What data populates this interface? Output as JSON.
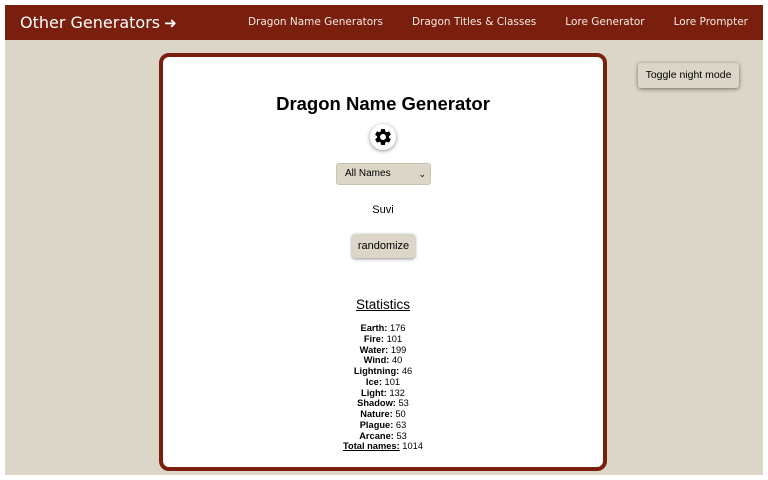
{
  "nav": {
    "brand": "Other Generators",
    "brand_icon": "arrow-right-icon",
    "links": [
      "Dragon Name Generators",
      "Dragon Titles & Classes",
      "Lore Generator",
      "Lore Prompter"
    ]
  },
  "card": {
    "title": "Dragon Name Generator",
    "settings_icon": "gear-icon",
    "select": {
      "value": "All Names"
    },
    "result": "Suvi",
    "randomize_label": "randomize",
    "stats": {
      "heading": "Statistics",
      "items": [
        {
          "label": "Earth:",
          "value": "176"
        },
        {
          "label": "Fire:",
          "value": "101"
        },
        {
          "label": "Water:",
          "value": "199"
        },
        {
          "label": "Wind:",
          "value": "40"
        },
        {
          "label": "Lightning:",
          "value": "46"
        },
        {
          "label": "Ice:",
          "value": "101"
        },
        {
          "label": "Light:",
          "value": "132"
        },
        {
          "label": "Shadow:",
          "value": "53"
        },
        {
          "label": "Nature:",
          "value": "50"
        },
        {
          "label": "Plague:",
          "value": "63"
        },
        {
          "label": "Arcane:",
          "value": "53"
        }
      ],
      "total": {
        "label": "Total names:",
        "value": "1014"
      }
    }
  },
  "night_mode_label": "Toggle night mode",
  "colors": {
    "accent": "#7a1f0d",
    "background": "#dbd6c8",
    "card": "#ffffff"
  }
}
